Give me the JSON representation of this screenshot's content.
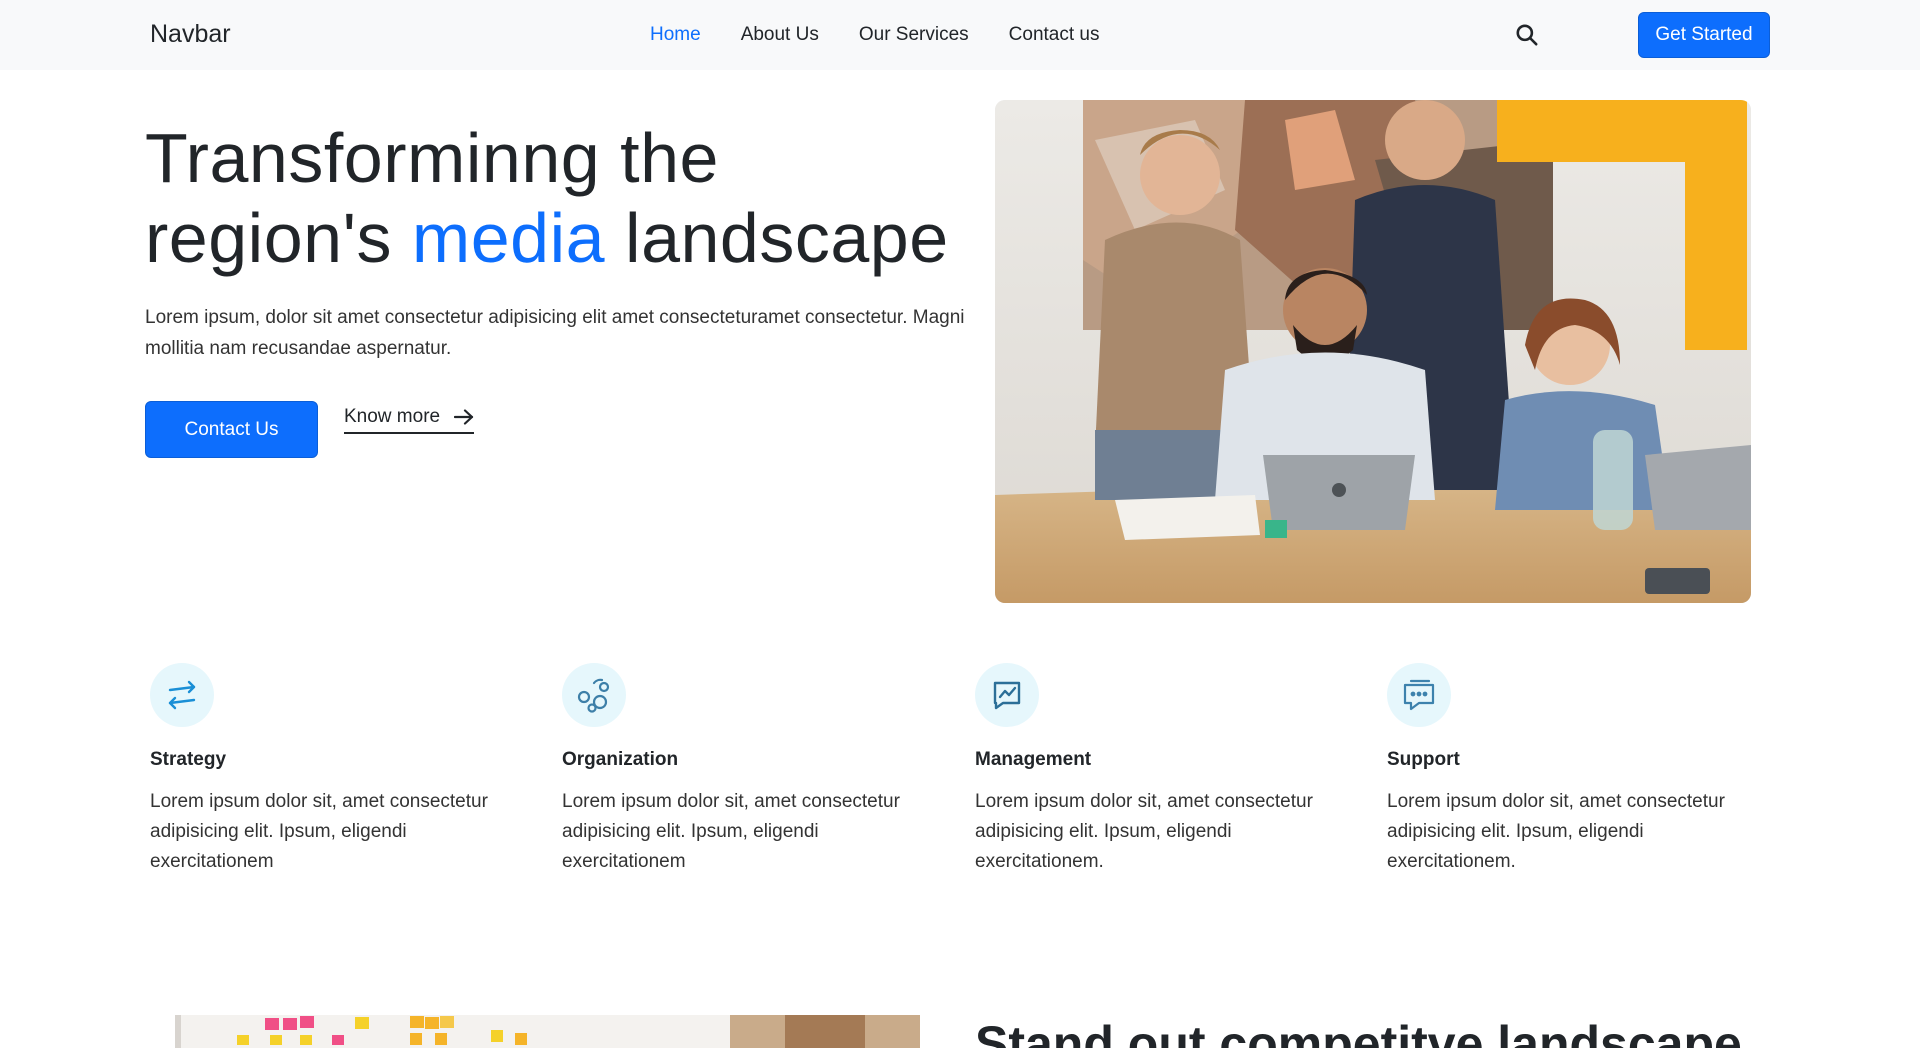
{
  "navbar": {
    "brand": "Navbar",
    "links": [
      {
        "label": "Home",
        "active": true
      },
      {
        "label": "About Us",
        "active": false
      },
      {
        "label": "Our Services",
        "active": false
      },
      {
        "label": "Contact us",
        "active": false
      }
    ],
    "search_icon": "search-icon",
    "cta_label": "Get Started"
  },
  "hero": {
    "title_line1": "Transforminng the",
    "title_line2_pre": "region's ",
    "title_line2_accent": "media",
    "title_line2_post": " landscape",
    "description": "Lorem ipsum, dolor sit amet consectetur adipisicing elit amet consecteturamet consectetur. Magni mollitia nam recusandae aspernatur.",
    "primary_button": "Contact Us",
    "secondary_link": "Know more",
    "image_icon": "team-photo"
  },
  "features": [
    {
      "title": "Strategy",
      "text": "Lorem ipsum dolor sit, amet consectetur adipisicing elit. Ipsum, eligendi exercitationem",
      "icon": "arrows-exchange-icon"
    },
    {
      "title": "Organization",
      "text": "Lorem ipsum dolor sit, amet consectetur adipisicing elit. Ipsum, eligendi exercitationem",
      "icon": "bubbles-icon"
    },
    {
      "title": "Management",
      "text": "Lorem ipsum dolor sit, amet consectetur adipisicing elit. Ipsum, eligendi exercitationem.",
      "icon": "chart-line-icon"
    },
    {
      "title": "Support",
      "text": "Lorem ipsum dolor sit, amet consectetur adipisicing elit. Ipsum, eligendi exercitationem.",
      "icon": "chat-dots-icon"
    }
  ],
  "second_section": {
    "title": "Stand out competitve landscape"
  },
  "colors": {
    "primary": "#0d6efd",
    "navbar_bg": "#f8f9fa",
    "icon_bg": "#e6f7fc",
    "yellow_accent": "#f7b01d"
  }
}
